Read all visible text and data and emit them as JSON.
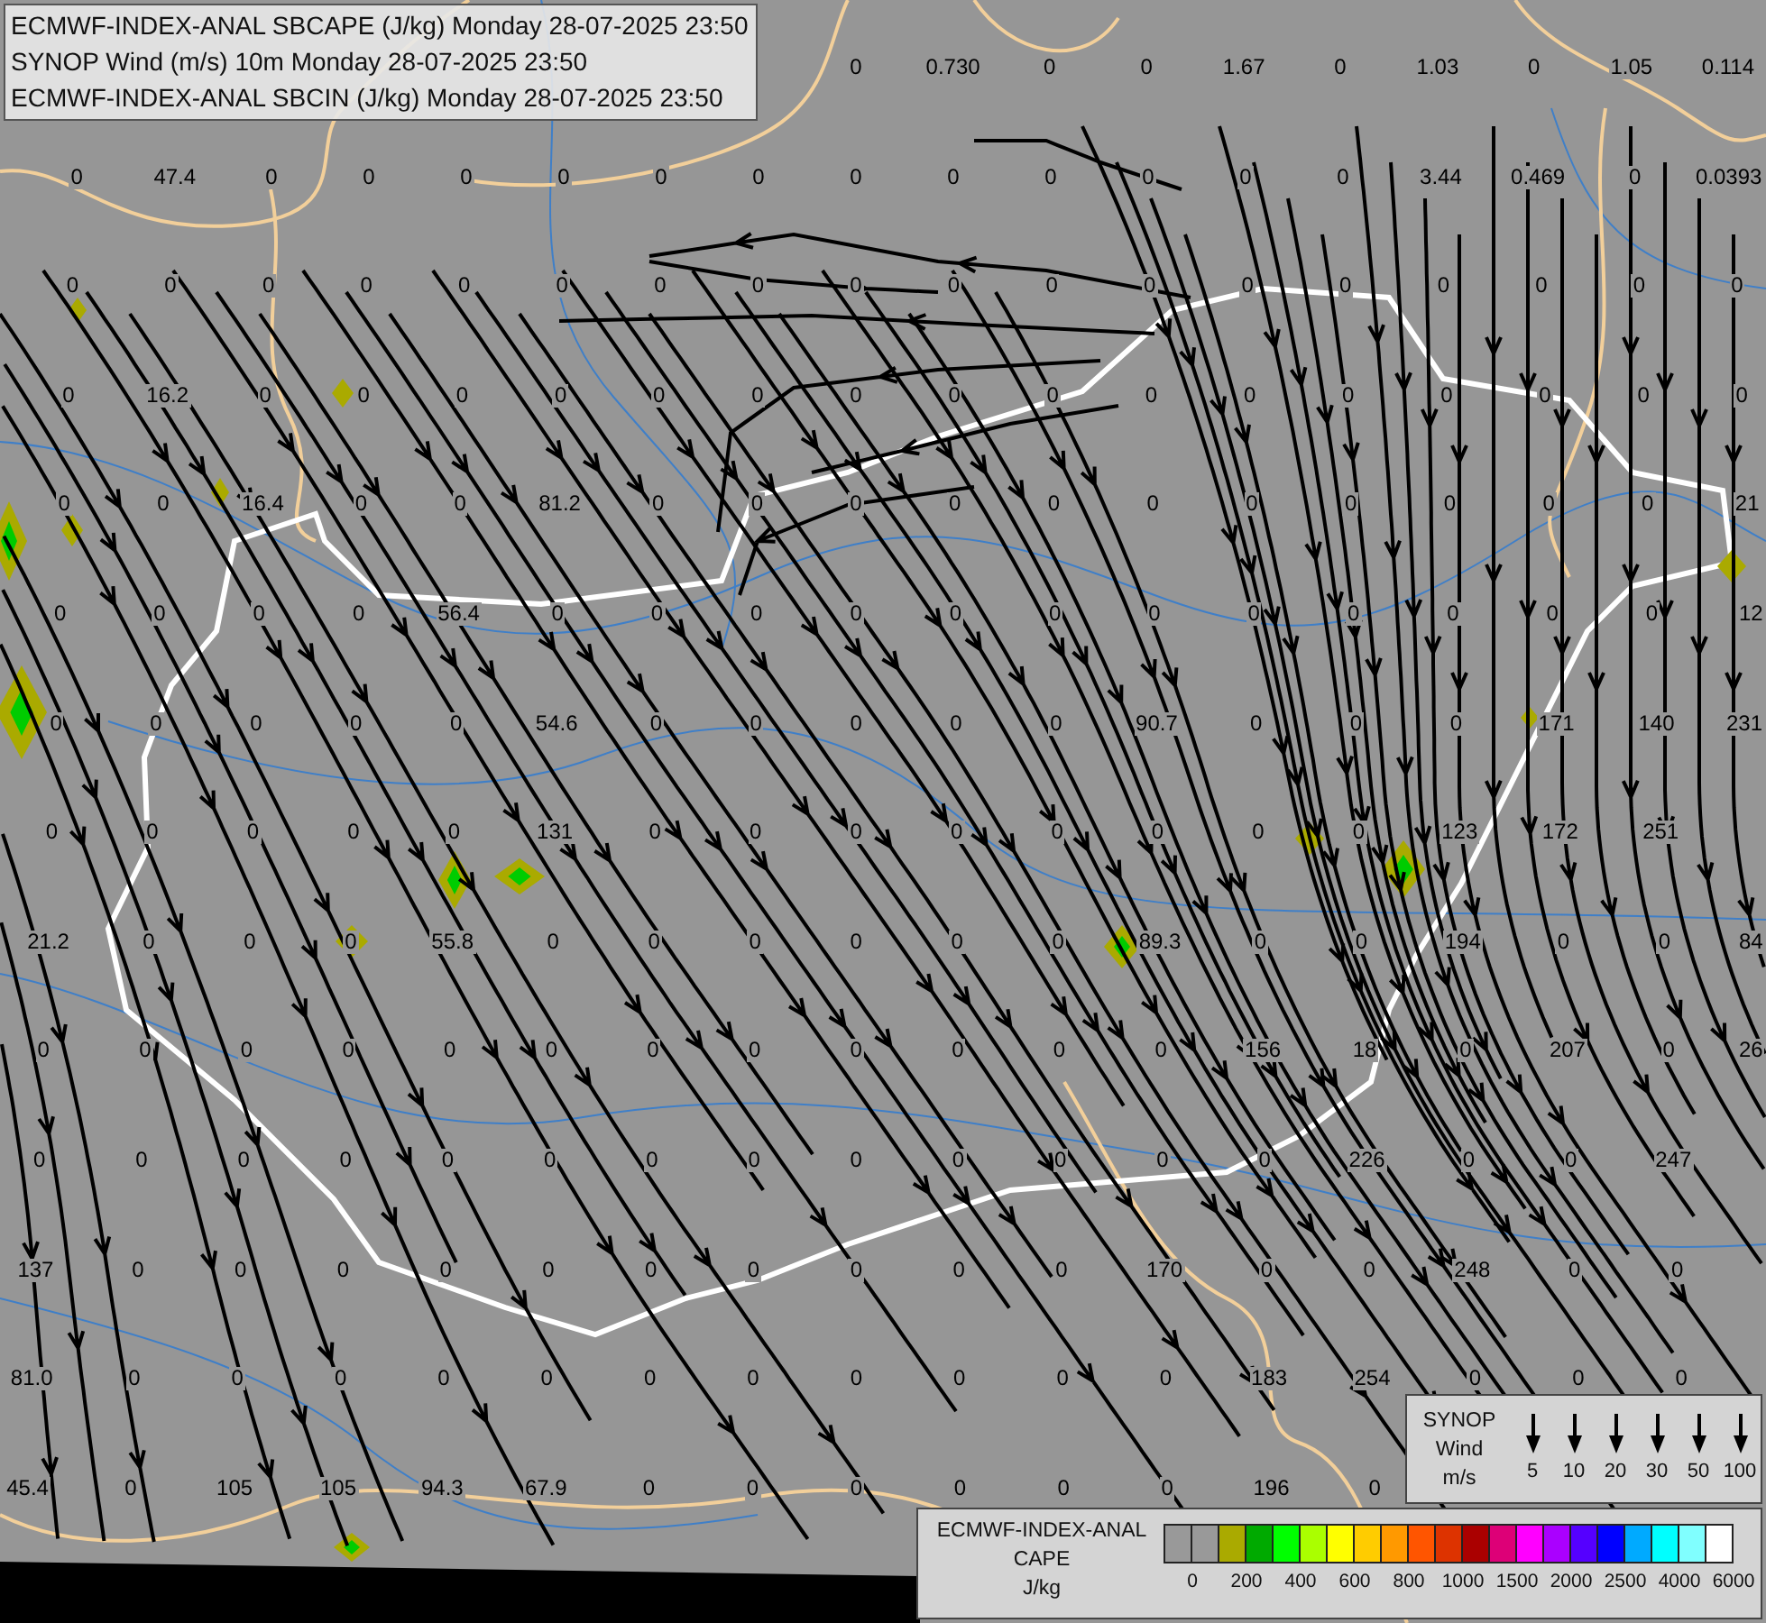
{
  "header": {
    "lines": [
      "ECMWF-INDEX-ANAL SBCAPE (J/kg) Monday 28-07-2025 23:50",
      "SYNOP Wind (m/s) 10m Monday 28-07-2025 23:50",
      "ECMWF-INDEX-ANAL SBCIN (J/kg) Monday 28-07-2025 23:50"
    ]
  },
  "cape_grid": {
    "rows": [
      [
        null,
        null,
        null,
        null,
        null,
        null,
        null,
        null,
        "0",
        "0.730",
        "0",
        "0",
        "1.67",
        "0",
        "1.03",
        "0",
        "1.05",
        "0.114"
      ],
      [
        "0",
        "47.4",
        "0",
        "0",
        "0",
        "0",
        "0",
        "0",
        "0",
        "0",
        "0",
        "0",
        "0",
        "0",
        "3.44",
        "0.469",
        "0",
        "0.0393"
      ],
      [
        "0",
        "0",
        "0",
        "0",
        "0",
        "0",
        "0",
        "0",
        "0",
        "0",
        "0",
        "0",
        "0",
        "0",
        "0",
        "0",
        "0",
        "0"
      ],
      [
        "0",
        "16.2",
        "0",
        "0",
        "0",
        "0",
        "0",
        "0",
        "0",
        "0",
        "0",
        "0",
        "0",
        "0",
        "0",
        "0",
        "0",
        "0"
      ],
      [
        "0",
        "0",
        "16.4",
        "0",
        "0",
        "81.2",
        "0",
        "0",
        "0",
        "0",
        "0",
        "0",
        "0",
        "0",
        "0",
        "0",
        "0",
        "21"
      ],
      [
        "0",
        "0",
        "0",
        "0",
        "56.4",
        "0",
        "0",
        "0",
        "0",
        "0",
        "0",
        "0",
        "0",
        "0",
        "0",
        "0",
        "0",
        "12"
      ],
      [
        "0",
        "0",
        "0",
        "0",
        "0",
        "54.6",
        "0",
        "0",
        "0",
        "0",
        "0",
        "90.7",
        "0",
        "0",
        "0",
        "171",
        "140",
        "231"
      ],
      [
        "0",
        "0",
        "0",
        "0",
        "0",
        "131",
        "0",
        "0",
        "0",
        "0",
        "0",
        "0",
        "0",
        "0",
        "123",
        "172",
        "251",
        null
      ],
      [
        "21.2",
        "0",
        "0",
        "0",
        "55.8",
        "0",
        "0",
        "0",
        "0",
        "0",
        "0",
        "89.3",
        "0",
        "0",
        "194",
        "0",
        "0",
        "84"
      ],
      [
        "0",
        "0",
        "0",
        "0",
        "0",
        "0",
        "0",
        "0",
        "0",
        "0",
        "0",
        "0",
        "156",
        "18",
        "0",
        "207",
        "0",
        "26"
      ],
      [
        "0",
        "0",
        "0",
        "0",
        "0",
        "0",
        "0",
        "0",
        "0",
        "0",
        "0",
        "0",
        "0",
        "226",
        "0",
        "0",
        "247",
        null
      ],
      [
        "137",
        "0",
        "0",
        "0",
        "0",
        "0",
        "0",
        "0",
        "0",
        "0",
        "0",
        "170",
        "0",
        "0",
        "248",
        "0",
        "0",
        null
      ],
      [
        "81.0",
        "0",
        "0",
        "0",
        "0",
        "0",
        "0",
        "0",
        "0",
        "0",
        "0",
        "0",
        "183",
        "254",
        "0",
        "0",
        "0",
        null
      ],
      [
        "45.4",
        "0",
        "105",
        "105",
        "94.3",
        "67.9",
        "0",
        "0",
        "0",
        "0",
        "0",
        "0",
        "196",
        "0",
        null,
        null,
        null,
        null
      ]
    ]
  },
  "synop_legend": {
    "title_lines": [
      "SYNOP",
      "Wind",
      "m/s"
    ],
    "speeds": [
      "5",
      "10",
      "20",
      "30",
      "50",
      "100"
    ]
  },
  "cape_legend": {
    "title_lines": [
      "ECMWF-INDEX-ANAL",
      "CAPE",
      "J/kg"
    ],
    "swatches": [
      {
        "color": "#999999"
      },
      {
        "color": "#999999"
      },
      {
        "color": "#aaaa00"
      },
      {
        "color": "#00aa00"
      },
      {
        "color": "#00ff00"
      },
      {
        "color": "#aaff00"
      },
      {
        "color": "#ffff00"
      },
      {
        "color": "#ffcc00"
      },
      {
        "color": "#ff9900"
      },
      {
        "color": "#ff5500"
      },
      {
        "color": "#dd3300"
      },
      {
        "color": "#aa0000"
      },
      {
        "color": "#dd0077"
      },
      {
        "color": "#ff00ff"
      },
      {
        "color": "#aa00ff"
      },
      {
        "color": "#5500ff"
      },
      {
        "color": "#0000ff"
      },
      {
        "color": "#00aaff"
      },
      {
        "color": "#00ffff"
      },
      {
        "color": "#80ffff"
      },
      {
        "color": "#ffffff"
      }
    ],
    "tick_labels": [
      "0",
      "200",
      "400",
      "600",
      "800",
      "1000",
      "1500",
      "2000",
      "2500",
      "4000",
      "6000"
    ]
  }
}
